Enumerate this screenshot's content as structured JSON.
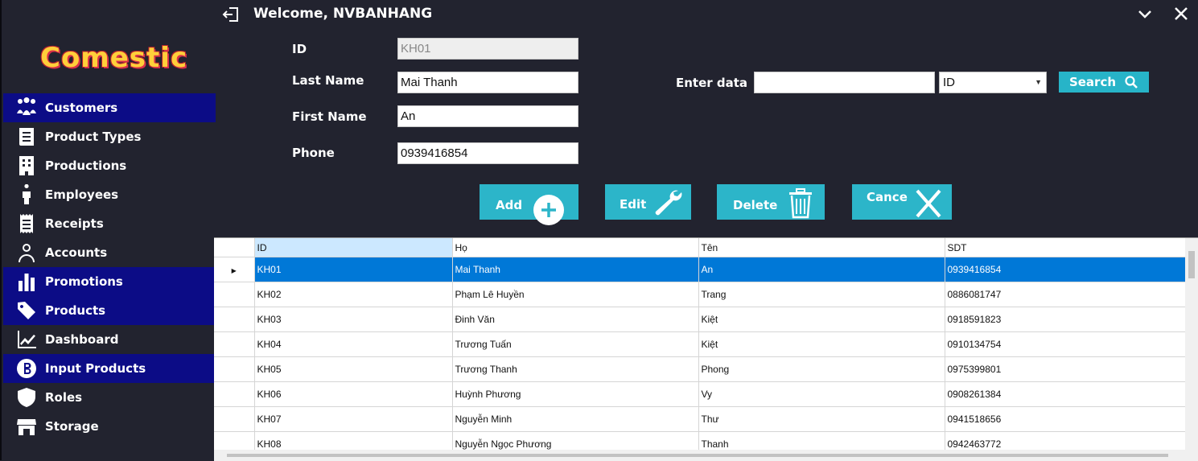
{
  "app": {
    "logo": "Comestic",
    "welcome": "Welcome, NVBANHANG"
  },
  "sidebar": {
    "items": [
      {
        "label": "Customers",
        "icon": "users-icon",
        "highlight": true
      },
      {
        "label": "Product Types",
        "icon": "book-icon",
        "highlight": false
      },
      {
        "label": "Productions",
        "icon": "building-icon",
        "highlight": false
      },
      {
        "label": "Employees",
        "icon": "person-icon",
        "highlight": false
      },
      {
        "label": "Receipts",
        "icon": "receipt-icon",
        "highlight": false
      },
      {
        "label": "Accounts",
        "icon": "user-icon",
        "highlight": false
      },
      {
        "label": "Promotions",
        "icon": "bar-chart-icon",
        "highlight": true
      },
      {
        "label": "Products",
        "icon": "tag-icon",
        "highlight": true
      },
      {
        "label": "Dashboard",
        "icon": "line-chart-icon",
        "highlight": false
      },
      {
        "label": "Input Products",
        "icon": "bitcoin-icon",
        "highlight": true
      },
      {
        "label": "Roles",
        "icon": "shield-icon",
        "highlight": false
      },
      {
        "label": "Storage",
        "icon": "store-icon",
        "highlight": false
      }
    ]
  },
  "form": {
    "id_label": "ID",
    "id_value": "KH01",
    "lastname_label": "Last Name",
    "lastname_value": "Mai Thanh",
    "firstname_label": "First Name",
    "firstname_value": "An",
    "phone_label": "Phone",
    "phone_value": "0939416854"
  },
  "search": {
    "label": "Enter data",
    "value": "",
    "field_selected": "ID",
    "button": "Search"
  },
  "actions": {
    "add": "Add",
    "edit": "Edit",
    "delete": "Delete",
    "cancel": "Cance"
  },
  "grid": {
    "columns": [
      "ID",
      "Họ",
      "Tên",
      "SDT"
    ],
    "rows": [
      [
        "KH01",
        "Mai Thanh",
        "An",
        "0939416854"
      ],
      [
        "KH02",
        "Phạm Lê Huyền",
        "Trang",
        "0886081747"
      ],
      [
        "KH03",
        "Đinh Văn",
        "Kiệt",
        "0918591823"
      ],
      [
        "KH04",
        "Trương Tuấn",
        "Kiệt",
        "0910134754"
      ],
      [
        "KH05",
        "Trương Thanh",
        "Phong",
        "0975399801"
      ],
      [
        "KH06",
        "Huỳnh Phương",
        "Vy",
        "0908261384"
      ],
      [
        "KH07",
        "Nguyễn Minh",
        "Thư",
        "0941518656"
      ],
      [
        "KH08",
        "Nguyễn Ngọc Phương",
        "Thanh",
        "0942463772"
      ]
    ],
    "selected_row": 0
  },
  "colors": {
    "background": "#22232f",
    "highlight": "#0c0c86",
    "accent": "#2cb5c9",
    "selection": "#0078d7"
  }
}
